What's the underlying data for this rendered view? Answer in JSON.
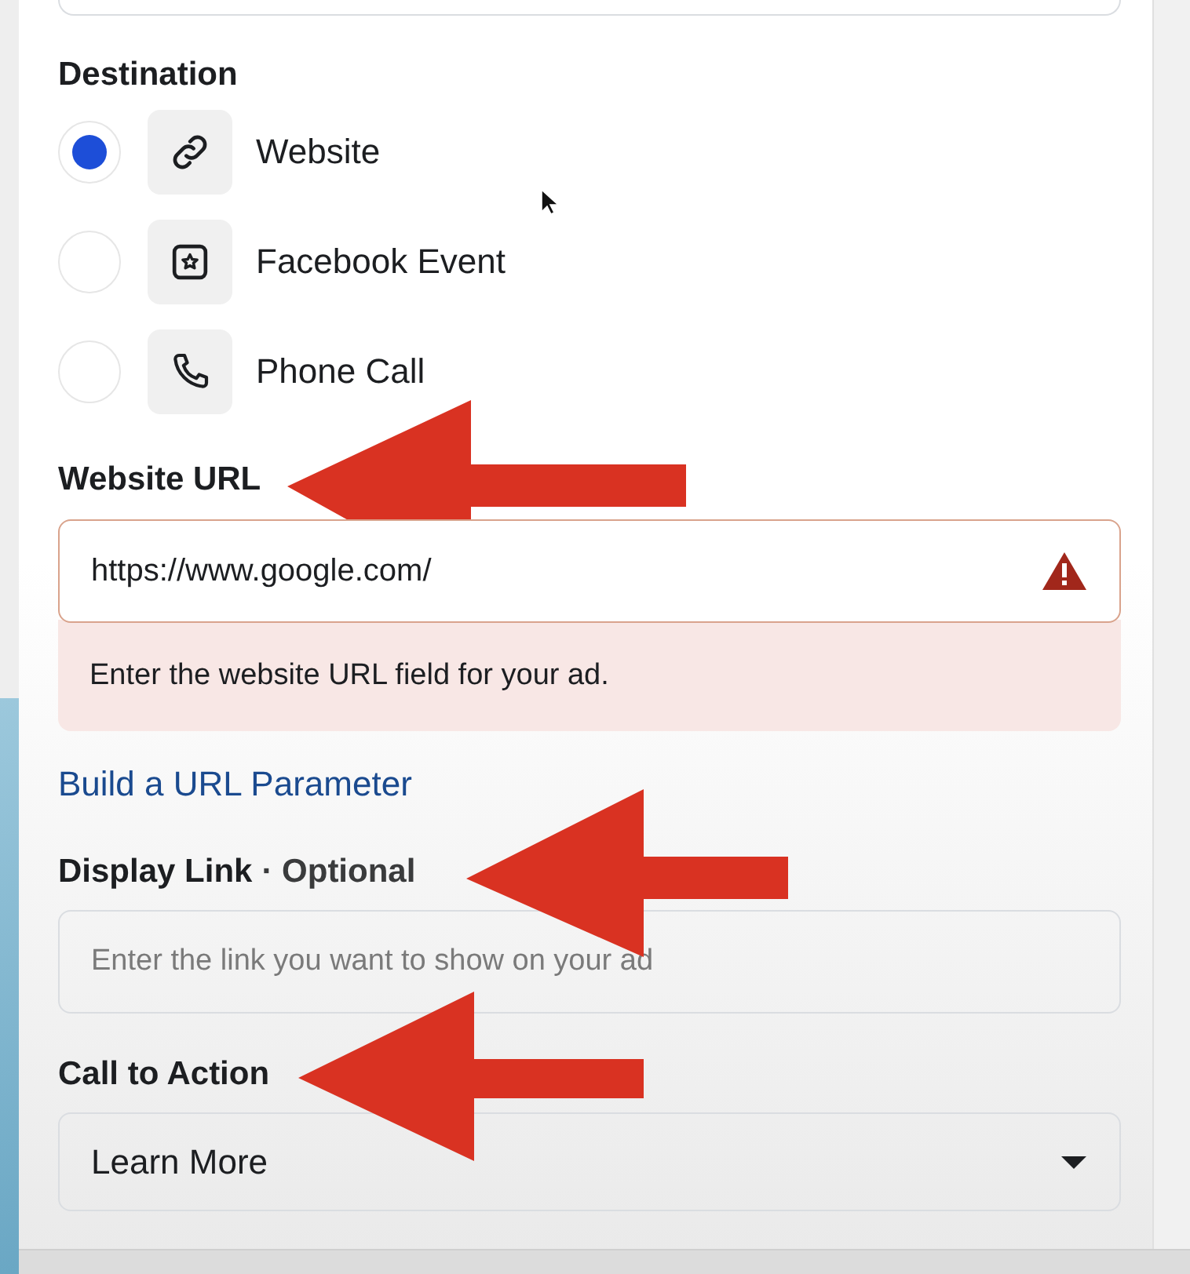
{
  "destination": {
    "label": "Destination",
    "options": [
      {
        "label": "Website",
        "selected": true
      },
      {
        "label": "Facebook Event",
        "selected": false
      },
      {
        "label": "Phone Call",
        "selected": false
      }
    ]
  },
  "website_url": {
    "label": "Website URL",
    "value": "https://www.google.com/",
    "invalid": true,
    "error": "Enter the website URL field for your ad."
  },
  "url_parameter_link": "Build a URL Parameter",
  "display_link": {
    "label": "Display Link",
    "note": "· Optional",
    "placeholder": "Enter the link you want to show on your ad"
  },
  "call_to_action": {
    "label": "Call to Action",
    "value": "Learn More"
  }
}
